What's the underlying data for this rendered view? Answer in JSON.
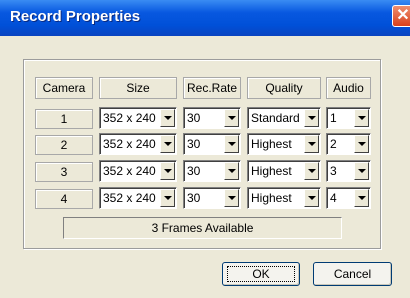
{
  "window": {
    "title": "Record Properties",
    "close_glyph": "✕"
  },
  "headers": [
    "Camera",
    "Size",
    "Rec.Rate",
    "Quality",
    "Audio"
  ],
  "rows": [
    {
      "camera": "1",
      "size": "352 x 240",
      "rate": "30",
      "quality": "Standard",
      "audio": "1"
    },
    {
      "camera": "2",
      "size": "352 x 240",
      "rate": "30",
      "quality": "Highest",
      "audio": "2"
    },
    {
      "camera": "3",
      "size": "352 x 240",
      "rate": "30",
      "quality": "Highest",
      "audio": "3"
    },
    {
      "camera": "4",
      "size": "352 x 240",
      "rate": "30",
      "quality": "Highest",
      "audio": "4"
    }
  ],
  "frames_available": "3 Frames Available",
  "buttons": {
    "ok": "OK",
    "cancel": "Cancel"
  },
  "colors": {
    "title_bar": "#0858e0",
    "close_button": "#d8401c",
    "dialog_bg": "#ece9d8"
  }
}
